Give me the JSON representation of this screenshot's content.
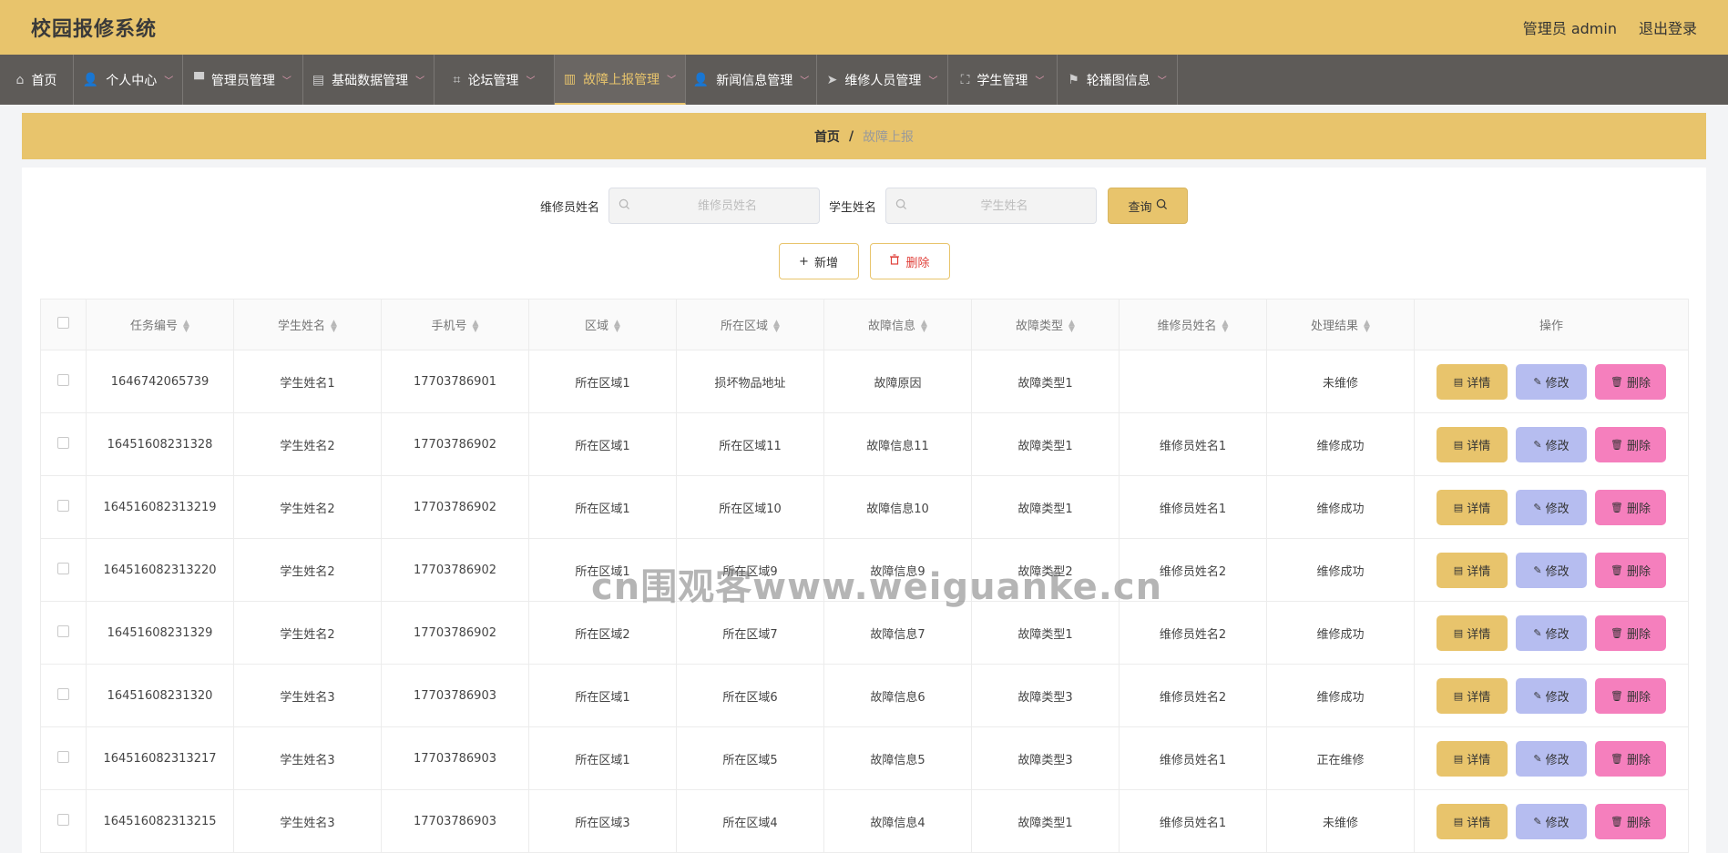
{
  "header": {
    "app_title": "校园报修系统",
    "user_label": "管理员 admin",
    "logout_label": "退出登录"
  },
  "nav": {
    "items": [
      {
        "label": "首页",
        "icon": "home-icon",
        "has_menu": false,
        "active": false
      },
      {
        "label": "个人中心",
        "icon": "user-icon",
        "has_menu": true,
        "active": false
      },
      {
        "label": "管理员管理",
        "icon": "stamp-icon",
        "has_menu": true,
        "active": false
      },
      {
        "label": "基础数据管理",
        "icon": "printer-icon",
        "has_menu": true,
        "active": false
      },
      {
        "label": "论坛管理",
        "icon": "crop-icon",
        "has_menu": true,
        "active": false
      },
      {
        "label": "故障上报管理",
        "icon": "clipboard-icon",
        "has_menu": true,
        "active": true
      },
      {
        "label": "新闻信息管理",
        "icon": "user-icon",
        "has_menu": true,
        "active": false
      },
      {
        "label": "维修人员管理",
        "icon": "send-icon",
        "has_menu": true,
        "active": false
      },
      {
        "label": "学生管理",
        "icon": "fullscreen-icon",
        "has_menu": true,
        "active": false
      },
      {
        "label": "轮播图信息",
        "icon": "flag-icon",
        "has_menu": true,
        "active": false
      }
    ]
  },
  "breadcrumb": {
    "home": "首页",
    "separator": "/",
    "current": "故障上报"
  },
  "search": {
    "field1_label": "维修员姓名",
    "field1_placeholder": "维修员姓名",
    "field2_label": "学生姓名",
    "field2_placeholder": "学生姓名",
    "query_label": "查询"
  },
  "actions": {
    "add_label": "新增",
    "delete_label": "删除"
  },
  "table": {
    "columns": [
      "任务编号",
      "学生姓名",
      "手机号",
      "区域",
      "所在区域",
      "故障信息",
      "故障类型",
      "维修员姓名",
      "处理结果",
      "操作"
    ],
    "row_buttons": {
      "detail": "详情",
      "edit": "修改",
      "remove": "删除"
    },
    "rows": [
      [
        "1646742065739",
        "学生姓名1",
        "17703786901",
        "所在区域1",
        "损坏物品地址",
        "故障原因",
        "故障类型1",
        "",
        "未维修"
      ],
      [
        "16451608231328",
        "学生姓名2",
        "17703786902",
        "所在区域1",
        "所在区域11",
        "故障信息11",
        "故障类型1",
        "维修员姓名1",
        "维修成功"
      ],
      [
        "164516082313219",
        "学生姓名2",
        "17703786902",
        "所在区域1",
        "所在区域10",
        "故障信息10",
        "故障类型1",
        "维修员姓名1",
        "维修成功"
      ],
      [
        "164516082313220",
        "学生姓名2",
        "17703786902",
        "所在区域1",
        "所在区域9",
        "故障信息9",
        "故障类型2",
        "维修员姓名2",
        "维修成功"
      ],
      [
        "16451608231329",
        "学生姓名2",
        "17703786902",
        "所在区域2",
        "所在区域7",
        "故障信息7",
        "故障类型1",
        "维修员姓名2",
        "维修成功"
      ],
      [
        "16451608231320",
        "学生姓名3",
        "17703786903",
        "所在区域1",
        "所在区域6",
        "故障信息6",
        "故障类型3",
        "维修员姓名2",
        "维修成功"
      ],
      [
        "164516082313217",
        "学生姓名3",
        "17703786903",
        "所在区域1",
        "所在区域5",
        "故障信息5",
        "故障类型3",
        "维修员姓名1",
        "正在维修"
      ],
      [
        "164516082313215",
        "学生姓名3",
        "17703786903",
        "所在区域3",
        "所在区域4",
        "故障信息4",
        "故障类型1",
        "维修员姓名1",
        "未维修"
      ]
    ]
  },
  "watermark": "cn围观客www.weiguanke.cn",
  "colors": {
    "accent": "#e8c46c",
    "nav_bg": "#5e5b58",
    "edit_btn": "#b6bdf0",
    "remove_btn": "#f57fbd",
    "danger_text": "#e0403a"
  }
}
